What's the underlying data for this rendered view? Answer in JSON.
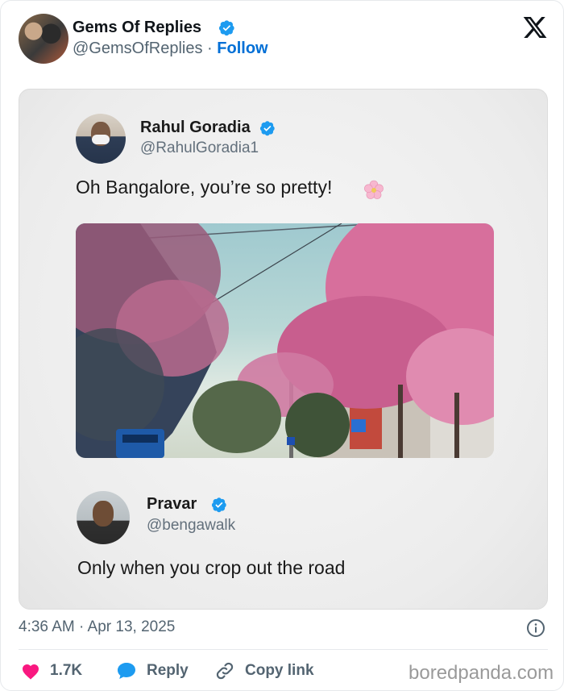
{
  "header": {
    "account_name": "Gems Of Replies",
    "handle": "@GemsOfReplies",
    "separator": "·",
    "follow_label": "Follow",
    "platform_icon": "x-logo-icon"
  },
  "embedded": {
    "tweet1": {
      "name": "Rahul Goradia",
      "handle": "@RahulGoradia1",
      "text": "Oh Bangalore, you’re so pretty!",
      "emoji_icon": "cherry-blossom-icon"
    },
    "photo": {
      "description_icon": "street-blossom-photo"
    },
    "tweet2": {
      "name": "Pravar",
      "handle": "@bengawalk",
      "text": "Only when you crop out the road"
    }
  },
  "footer": {
    "timestamp": "4:36 AM · Apr 13, 2025",
    "likes": "1.7K",
    "reply_label": "Reply",
    "copy_link_label": "Copy link"
  },
  "watermark": "boredpanda.com",
  "colors": {
    "verified": "#1d9bf0",
    "follow": "#006fd6",
    "like": "#f91880",
    "reply": "#1d9bf0",
    "muted": "#536471"
  }
}
